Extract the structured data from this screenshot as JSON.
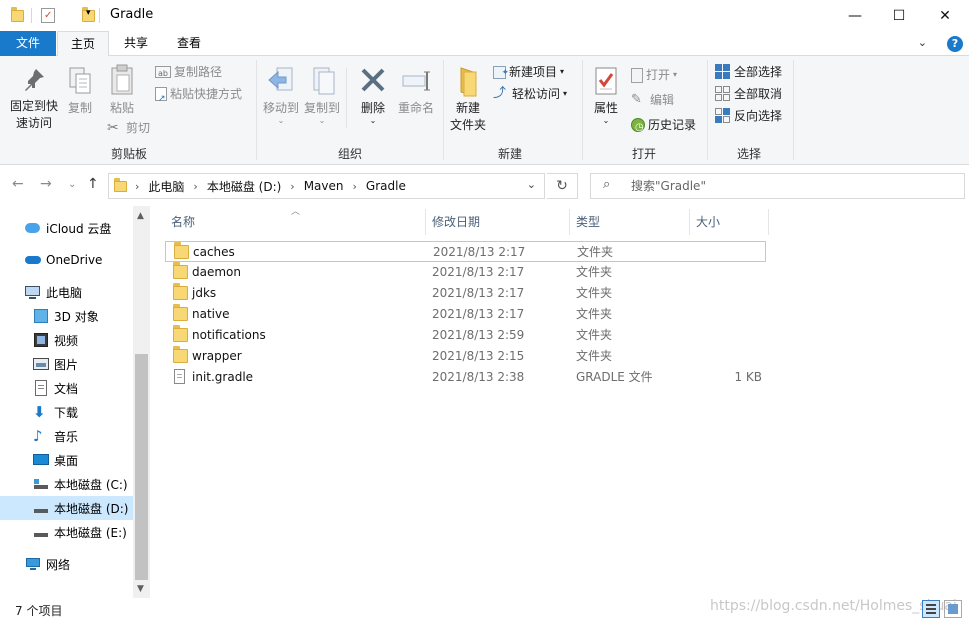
{
  "window": {
    "title": "Gradle",
    "controls": {
      "minimize": "—",
      "maximize": "☐",
      "close": "✕"
    }
  },
  "ribbon_tabs": [
    "文件",
    "主页",
    "共享",
    "查看"
  ],
  "ribbon": {
    "clipboard": {
      "pin_label_1": "固定到快",
      "pin_label_2": "速访问",
      "copy": "复制",
      "paste": "粘贴",
      "copy_path": "复制路径",
      "paste_shortcut": "粘贴快捷方式",
      "cut": "剪切",
      "group": "剪贴板"
    },
    "organize": {
      "move_to": "移动到",
      "copy_to": "复制到",
      "delete": "删除",
      "rename": "重命名",
      "group": "组织"
    },
    "new": {
      "new_folder_1": "新建",
      "new_folder_2": "文件夹",
      "new_item": "新建项目",
      "easy_access": "轻松访问",
      "group": "新建"
    },
    "open": {
      "properties": "属性",
      "open": "打开",
      "edit": "编辑",
      "history": "历史记录",
      "group": "打开"
    },
    "select": {
      "select_all": "全部选择",
      "select_none": "全部取消",
      "invert": "反向选择",
      "group": "选择"
    }
  },
  "address": {
    "crumbs": [
      "此电脑",
      "本地磁盘 (D:)",
      "Maven",
      "Gradle"
    ]
  },
  "search": {
    "placeholder": "搜索\"Gradle\""
  },
  "nav_pane": {
    "items": [
      {
        "label": "iCloud 云盘",
        "icon": "icloud-icon"
      },
      {
        "label": "OneDrive",
        "icon": "onedrive-icon"
      },
      {
        "label": "此电脑",
        "icon": "computer-icon"
      },
      {
        "label": "3D 对象",
        "icon": "3d-objects-icon"
      },
      {
        "label": "视频",
        "icon": "video-icon"
      },
      {
        "label": "图片",
        "icon": "pictures-icon"
      },
      {
        "label": "文档",
        "icon": "documents-icon"
      },
      {
        "label": "下载",
        "icon": "download-icon"
      },
      {
        "label": "音乐",
        "icon": "music-icon"
      },
      {
        "label": "桌面",
        "icon": "desktop-icon"
      },
      {
        "label": "本地磁盘 (C:)",
        "icon": "drive-c-icon"
      },
      {
        "label": "本地磁盘 (D:)",
        "icon": "drive-d-icon"
      },
      {
        "label": "本地磁盘 (E:)",
        "icon": "drive-e-icon"
      },
      {
        "label": "网络",
        "icon": "network-icon"
      }
    ],
    "selected": "本地磁盘 (D:)"
  },
  "columns": {
    "name": "名称",
    "modified": "修改日期",
    "type": "类型",
    "size": "大小"
  },
  "files": [
    {
      "name": "caches",
      "modified": "2021/8/13 2:17",
      "type": "文件夹",
      "size": "",
      "kind": "folder"
    },
    {
      "name": "daemon",
      "modified": "2021/8/13 2:17",
      "type": "文件夹",
      "size": "",
      "kind": "folder"
    },
    {
      "name": "jdks",
      "modified": "2021/8/13 2:17",
      "type": "文件夹",
      "size": "",
      "kind": "folder"
    },
    {
      "name": "native",
      "modified": "2021/8/13 2:17",
      "type": "文件夹",
      "size": "",
      "kind": "folder"
    },
    {
      "name": "notifications",
      "modified": "2021/8/13 2:59",
      "type": "文件夹",
      "size": "",
      "kind": "folder"
    },
    {
      "name": "wrapper",
      "modified": "2021/8/13 2:15",
      "type": "文件夹",
      "size": "",
      "kind": "folder"
    },
    {
      "name": "init.gradle",
      "modified": "2021/8/13 2:38",
      "type": "GRADLE 文件",
      "size": "1 KB",
      "kind": "file"
    }
  ],
  "status": {
    "count": "7 个项目"
  },
  "watermark": "https://blog.csdn.net/Holmes_shuai",
  "colors": {
    "accent": "#1979ca",
    "selection": "#cce8ff",
    "folder": "#f8d775",
    "header_text": "#4c607a"
  }
}
